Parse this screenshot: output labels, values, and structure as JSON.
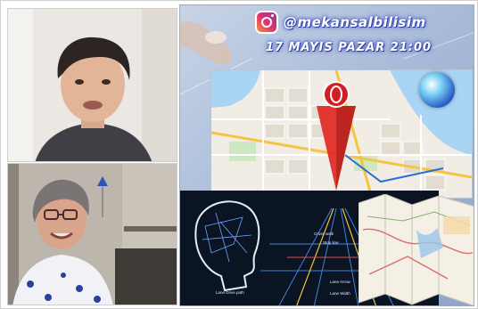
{
  "presentation": {
    "instagram_handle": "@mekansalbilisim",
    "event_date": "17 MAYIS PAZAR 21:00",
    "nav_labels": {
      "cross_walk": "Cross walk",
      "stop_line": "Stop line",
      "lane_arrow": "Lane Arrow",
      "lane_width": "Lane Width",
      "lane_drive_path": "Lane  Drive path"
    }
  },
  "colors": {
    "handle_glow": "#3a4fbf",
    "pin_red": "#d21f26",
    "nav_background": "#0a1422"
  }
}
